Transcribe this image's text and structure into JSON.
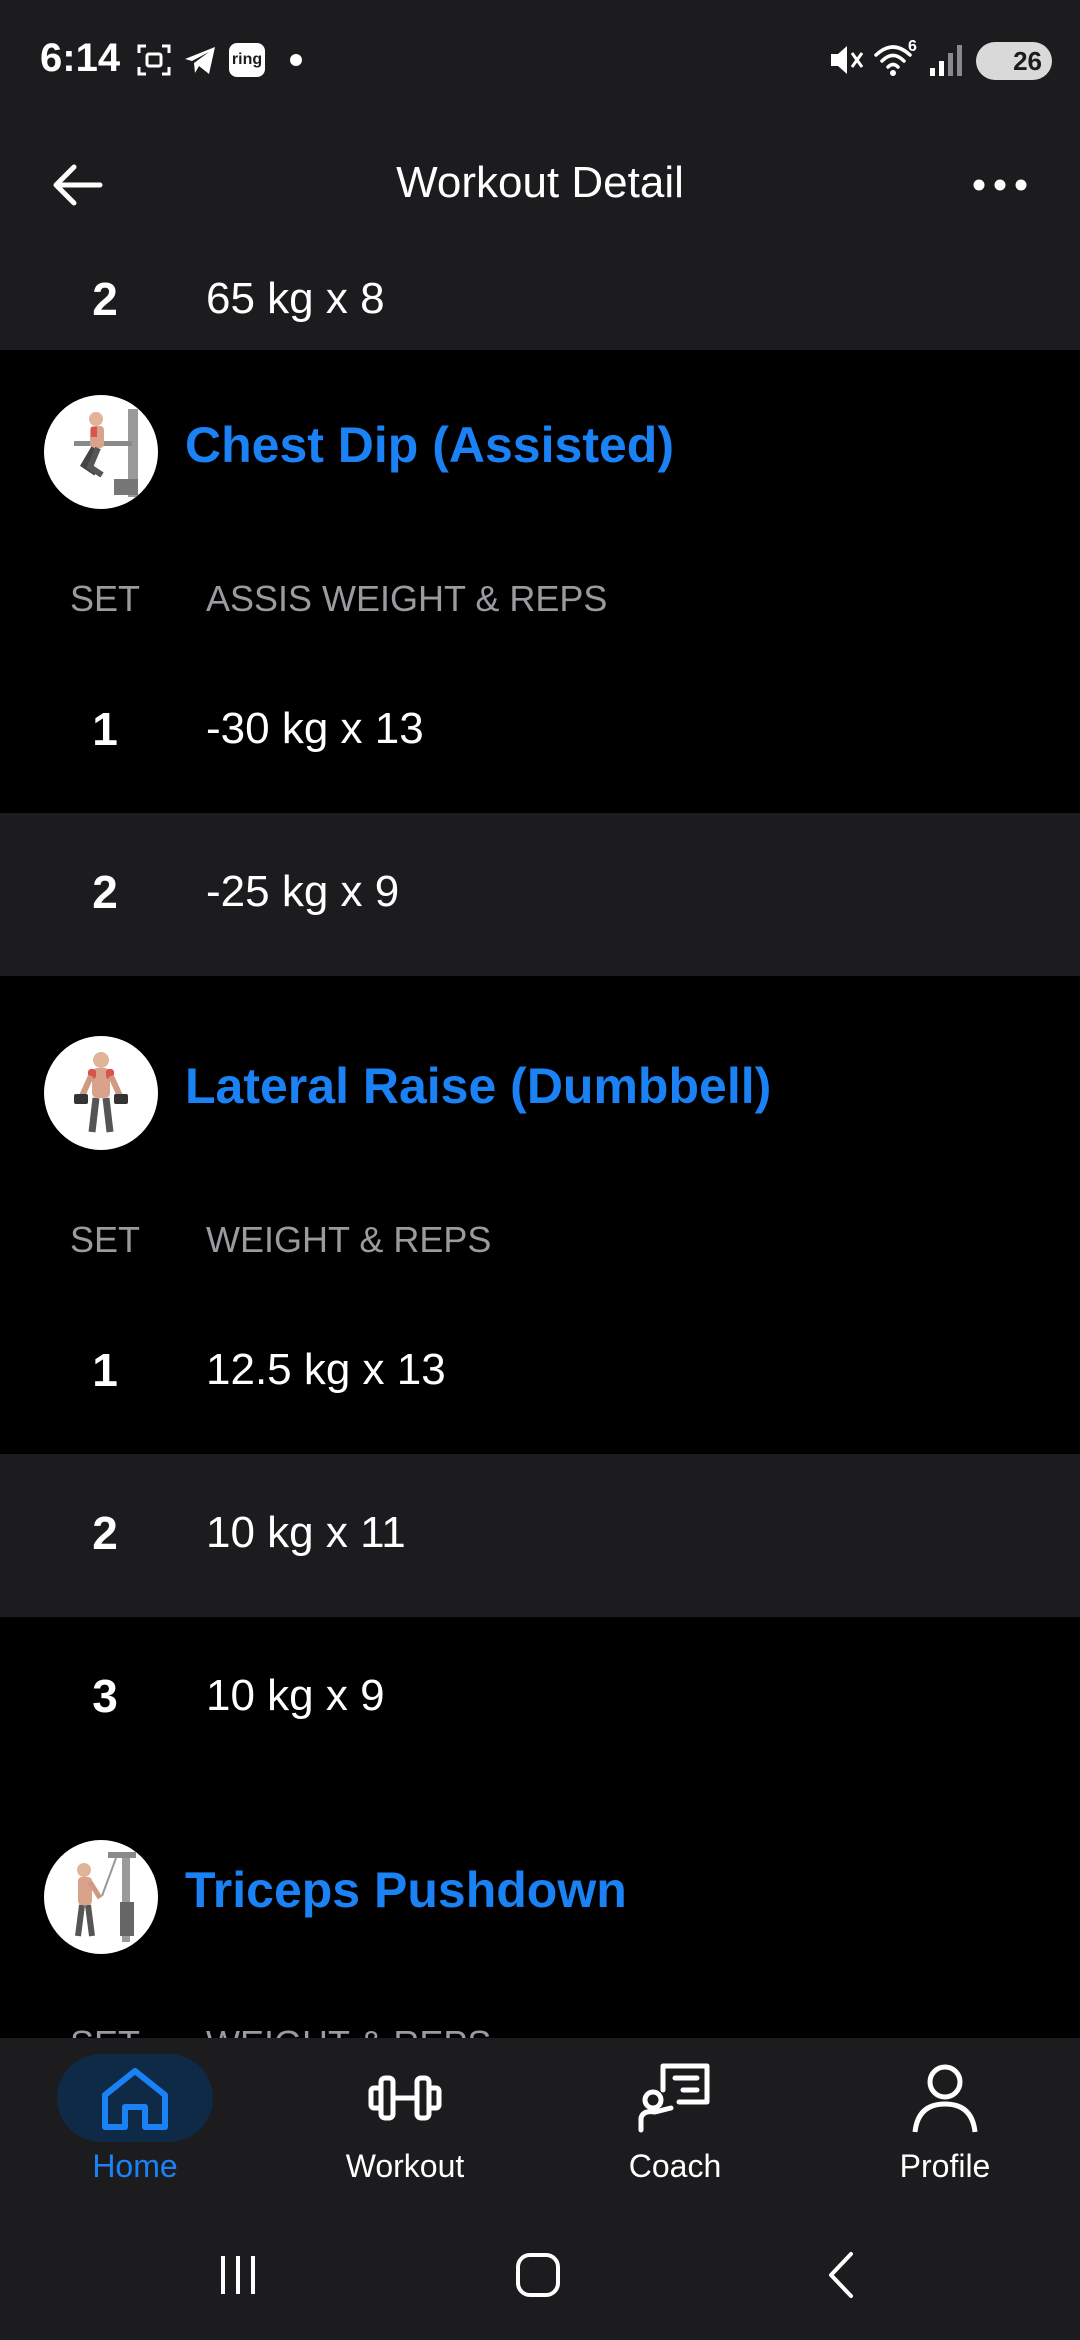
{
  "status": {
    "time": "6:14",
    "battery": "26",
    "icons": [
      "screenshot-icon",
      "telegram-icon",
      "ring-app-icon",
      "dot-icon",
      "mute-icon",
      "wifi-icon",
      "signal-icon",
      "battery-icon"
    ],
    "ring_label": "ring",
    "wifi_badge": "6"
  },
  "app_bar": {
    "title": "Workout Detail"
  },
  "partial_row": {
    "set": "2",
    "value": "65 kg x 8"
  },
  "exercises": [
    {
      "name": "Chest Dip (Assisted)",
      "col_set": "SET",
      "col_label": "ASSIS WEIGHT & REPS",
      "sets": [
        {
          "set": "1",
          "value": "-30 kg x 13"
        },
        {
          "set": "2",
          "value": "-25 kg x 9"
        }
      ]
    },
    {
      "name": "Lateral Raise (Dumbbell)",
      "col_set": "SET",
      "col_label": "WEIGHT & REPS",
      "sets": [
        {
          "set": "1",
          "value": "12.5 kg x 13"
        },
        {
          "set": "2",
          "value": "10 kg x 11"
        },
        {
          "set": "3",
          "value": "10 kg x 9"
        }
      ]
    },
    {
      "name": "Triceps Pushdown",
      "col_set": "SET",
      "col_label": "WEIGHT & REPS"
    }
  ],
  "nav": {
    "items": [
      {
        "label": "Home",
        "icon": "home-icon",
        "active": true
      },
      {
        "label": "Workout",
        "icon": "dumbbell-icon",
        "active": false
      },
      {
        "label": "Coach",
        "icon": "coach-icon",
        "active": false
      },
      {
        "label": "Profile",
        "icon": "profile-icon",
        "active": false
      }
    ]
  },
  "colors": {
    "accent": "#1a82f5",
    "surface": "#1c1c1e",
    "background": "#000000",
    "muted_text": "#9a9a9f"
  }
}
